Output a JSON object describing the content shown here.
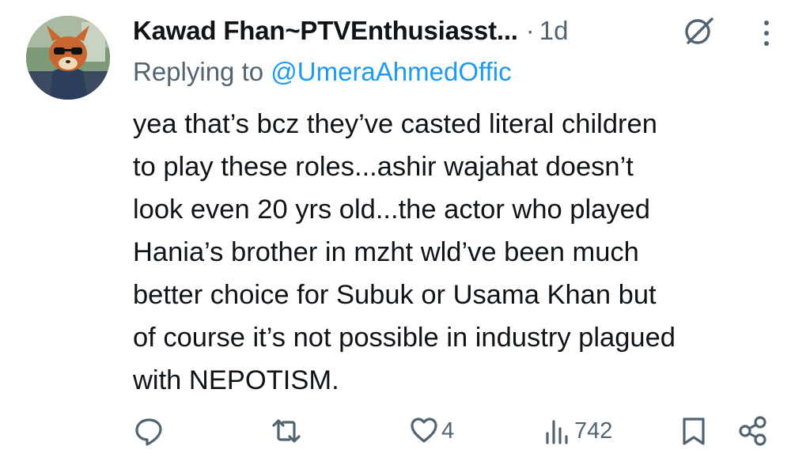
{
  "tweet": {
    "author_name": "Kawad Fhan~PTVEnthusiasst...",
    "separator": "·",
    "time": "1d",
    "replying_prefix": "Replying to ",
    "replying_handle": "@UmeraAhmedOffic",
    "body_lines": [
      "yea that’s bcz they’ve casted literal children",
      "to play these roles...ashir wajahat doesn’t",
      "look even 20 yrs old...the actor who played",
      "Hania’s brother in mzht wld’ve been much",
      "better choice for Subuk or Usama Khan but",
      "of course it’s not possible in industry plagued",
      "with NEPOTISM."
    ]
  },
  "actions": {
    "likes": "4",
    "views": "742"
  },
  "icons": {
    "grok": "grok-icon",
    "more": "more-vertical-icon",
    "reply": "reply-icon",
    "retweet": "retweet-icon",
    "like": "heart-icon",
    "views": "views-chart-icon",
    "bookmark": "bookmark-icon",
    "share": "share-icon"
  },
  "colors": {
    "text": "#0f1419",
    "secondary": "#536471",
    "link": "#1d9bf0"
  }
}
